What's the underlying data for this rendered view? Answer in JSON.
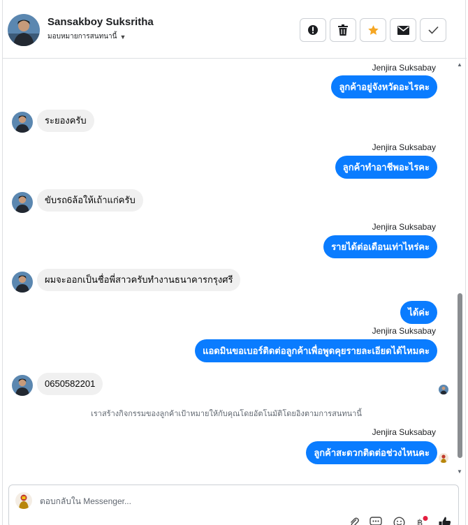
{
  "header": {
    "name": "Sansakboy Suksritha",
    "assign_label": "มอบหมายการสนทนานี้",
    "tools": [
      {
        "icon": "alert-icon"
      },
      {
        "icon": "trash-icon"
      },
      {
        "icon": "star-icon",
        "color": "#f5a623"
      },
      {
        "icon": "envelope-icon"
      },
      {
        "icon": "check-icon"
      }
    ]
  },
  "messages": [
    {
      "sender": "Jenjira Suksabay",
      "text": "ลูกค้าอยู่จังหวัดอะไรคะ"
    },
    {
      "text": "ระยองครับ"
    },
    {
      "sender": "Jenjira Suksabay",
      "text": "ลูกค้าทำอาชีพอะไรคะ"
    },
    {
      "text": "ขับรถ6ล้อให้เถ้าแก่ครับ"
    },
    {
      "sender": "Jenjira Suksabay",
      "text": "รายได้ต่อเดือนเท่าไหร่คะ"
    },
    {
      "text": "ผมจะออกเป็นชื่อพี่สาวครับทำงานธนาคารกรุงศรี"
    },
    {
      "text": "ได้ค่ะ"
    },
    {
      "sender": "Jenjira Suksabay",
      "text": "แอดมินขอเบอร์ติดต่อลูกค้าเพื่อพูดคุยรายละเอียดได้ไหมคะ"
    },
    {
      "text": "0650582201"
    },
    {
      "system": "เราสร้างกิจกรรมของลูกค้าเป้าหมายให้กับคุณโดยอัตโนมัติโดยอิงตามการสนทนานี้"
    },
    {
      "sender": "Jenjira Suksabay",
      "text": "ลูกค้าสะดวกติดต่อช่วงไหนคะ"
    }
  ],
  "composer": {
    "placeholder": "ตอบกลับใน Messenger..."
  },
  "colors": {
    "accent": "#0a7cff",
    "incoming_bubble": "#f0f0f0",
    "notification_dot": "#e41e3f"
  }
}
